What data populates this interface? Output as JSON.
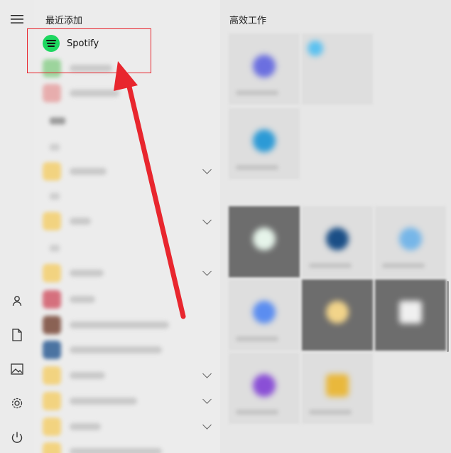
{
  "start_menu": {
    "recently_added_title": "最近添加",
    "highlighted_app": {
      "name": "Spotify",
      "icon": "spotify-logo-icon",
      "brand_color": "#1ed760"
    }
  },
  "tiles": {
    "group_title": "高效工作"
  },
  "rail": {
    "icons": [
      "hamburger-menu-icon",
      "user-icon",
      "document-icon",
      "pictures-icon",
      "settings-gear-icon",
      "power-icon"
    ]
  },
  "annotation": {
    "color": "#e8262e"
  }
}
